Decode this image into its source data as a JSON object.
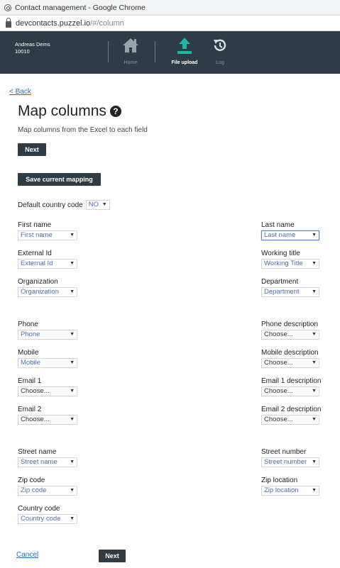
{
  "browser": {
    "window_title": "Contact management - Google Chrome",
    "url_host": "devcontacts.puzzel.io",
    "url_path": "/#/column"
  },
  "header": {
    "user_name": "Andreas Dems",
    "user_id": "10010",
    "nav": [
      {
        "label": "Home",
        "icon": "home-icon"
      },
      {
        "label": "File upload",
        "icon": "upload-icon"
      },
      {
        "label": "Log",
        "icon": "history-icon"
      }
    ]
  },
  "page": {
    "back_label": "< Back",
    "title": "Map columns",
    "help_glyph": "?",
    "subtitle": "Map columns from the Excel to each field",
    "next_label": "Next",
    "save_mapping_label": "Save current mapping",
    "default_country_label": "Default country code",
    "default_country_value": "NO",
    "cancel_label": "Cancel",
    "next_bottom_label": "Next"
  },
  "fields_left": [
    {
      "label": "First name",
      "value": "First name"
    },
    {
      "label": "External Id",
      "value": "External Id"
    },
    {
      "label": "Organization",
      "value": "Organization"
    },
    {
      "label": "Phone",
      "value": "Phone"
    },
    {
      "label": "Mobile",
      "value": "Mobile"
    },
    {
      "label": "Email 1",
      "value": "Choose..."
    },
    {
      "label": "Email 2",
      "value": "Choose..."
    },
    {
      "label": "Street name",
      "value": "Street name"
    },
    {
      "label": "Zip code",
      "value": "Zip code"
    },
    {
      "label": "Country code",
      "value": "Country code"
    }
  ],
  "fields_right": [
    {
      "label": "Last name",
      "value": "Last name"
    },
    {
      "label": "Working title",
      "value": "Working Title"
    },
    {
      "label": "Department",
      "value": "Department"
    },
    {
      "label": "Phone description",
      "value": "Choose..."
    },
    {
      "label": "Mobile description",
      "value": "Choose..."
    },
    {
      "label": "Email 1 description",
      "value": "Choose..."
    },
    {
      "label": "Email 2 description",
      "value": "Choose..."
    },
    {
      "label": "Street number",
      "value": "Street number"
    },
    {
      "label": "Zip location",
      "value": "Zip location"
    }
  ],
  "colors": {
    "header_bg": "#2f3b45",
    "accent_teal": "#1fb6a6",
    "link_blue": "#2a6ebb",
    "hint_blue": "#4a6fbf"
  }
}
